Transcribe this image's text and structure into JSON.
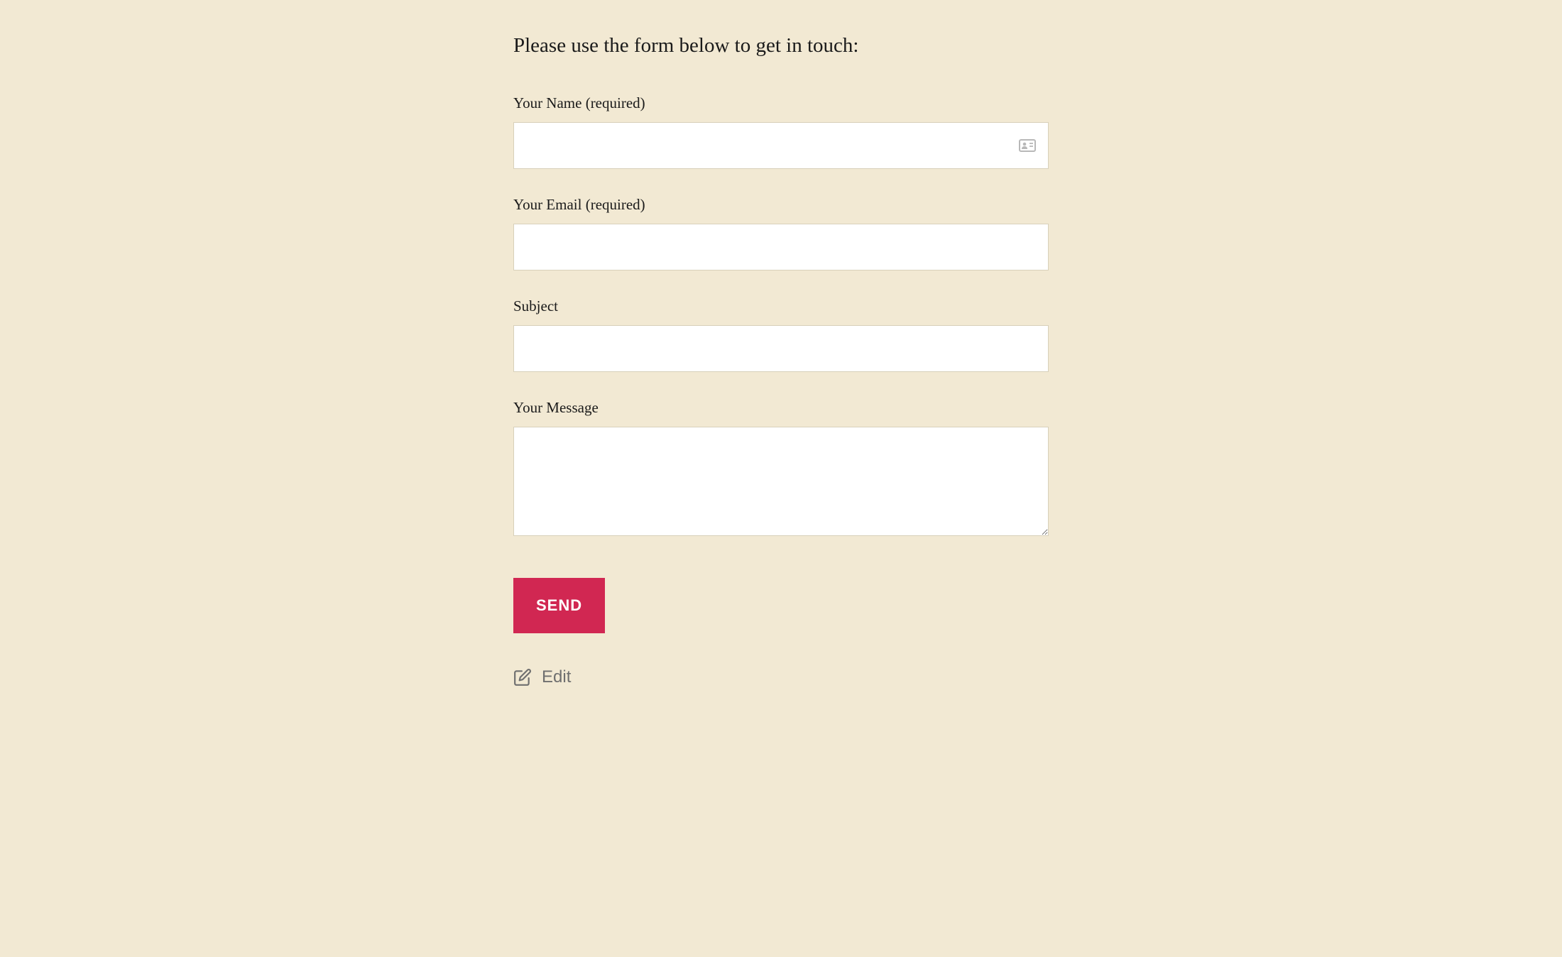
{
  "intro": "Please use the form below to get in touch:",
  "form": {
    "name": {
      "label": "Your Name (required)",
      "value": ""
    },
    "email": {
      "label": "Your Email (required)",
      "value": ""
    },
    "subject": {
      "label": "Subject",
      "value": ""
    },
    "message": {
      "label": "Your Message",
      "value": ""
    },
    "submit_label": "SEND"
  },
  "edit": {
    "label": "Edit"
  },
  "colors": {
    "background": "#f2e9d3",
    "accent": "#d12752",
    "text": "#1a1a1a",
    "muted": "#6f6f6f"
  },
  "icons": {
    "name_badge": "id-card-icon",
    "edit": "pencil-square-icon"
  }
}
